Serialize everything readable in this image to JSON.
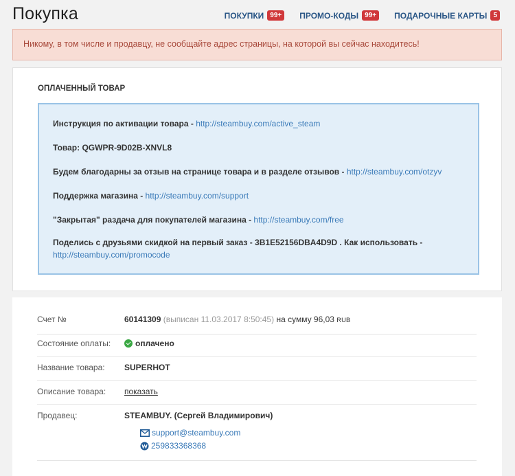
{
  "header": {
    "title": "Покупка",
    "nav": [
      {
        "label": "ПОКУПКИ",
        "badge": "99+"
      },
      {
        "label": "ПРОМО-КОДЫ",
        "badge": "99+"
      },
      {
        "label": "ПОДАРОЧНЫЕ КАРТЫ",
        "badge": "5"
      }
    ]
  },
  "warning": "Никому, в том числе и продавцу, не сообщайте адрес страницы, на которой вы сейчас находитесь!",
  "paid": {
    "title": "ОПЛАЧЕННЫЙ ТОВАР",
    "lines": [
      {
        "text": "Инструкция по активации товара - ",
        "link": "http://steambuy.com/active_steam"
      },
      {
        "text": "Товар: QGWPR-9D02B-XNVL8",
        "link": ""
      },
      {
        "text": "Будем благодарны за отзыв на странице товара и в разделе отзывов - ",
        "link": "http://steambuy.com/otzyv"
      },
      {
        "text": "Поддержка магазина - ",
        "link": "http://steambuy.com/support"
      },
      {
        "text": "\"Закрытая\" раздача для покупателей магазина - ",
        "link": "http://steambuy.com/free"
      },
      {
        "text": "Поделись с друзьями скидкой на первый заказ - 3B1E52156DBA4D9D . Как использовать - ",
        "link": "http://steambuy.com/promocode"
      }
    ]
  },
  "details": {
    "invoice_label": "Счет №",
    "invoice_number": "60141309",
    "invoice_issued": "(выписан 11.03.2017 8:50:45)",
    "invoice_sum_text": "на сумму 96,03",
    "invoice_currency": "RUB",
    "status_label": "Состояние оплаты:",
    "status_value": "оплачено",
    "product_label": "Название товара:",
    "product_value": "SUPERHOT",
    "description_label": "Описание товара:",
    "description_link": "показать",
    "seller_label": "Продавец:",
    "seller_value": "STEAMBUY. (Сергей Владимирович)",
    "seller_email": "support@steambuy.com",
    "seller_wallet": "259833368368"
  },
  "colors": {
    "accent": "#2a5686",
    "link": "#3a7ab8",
    "badge": "#d0383a",
    "success": "#3aa843",
    "warning_bg": "#f8ddd5",
    "info_bg": "#e3eff9"
  }
}
